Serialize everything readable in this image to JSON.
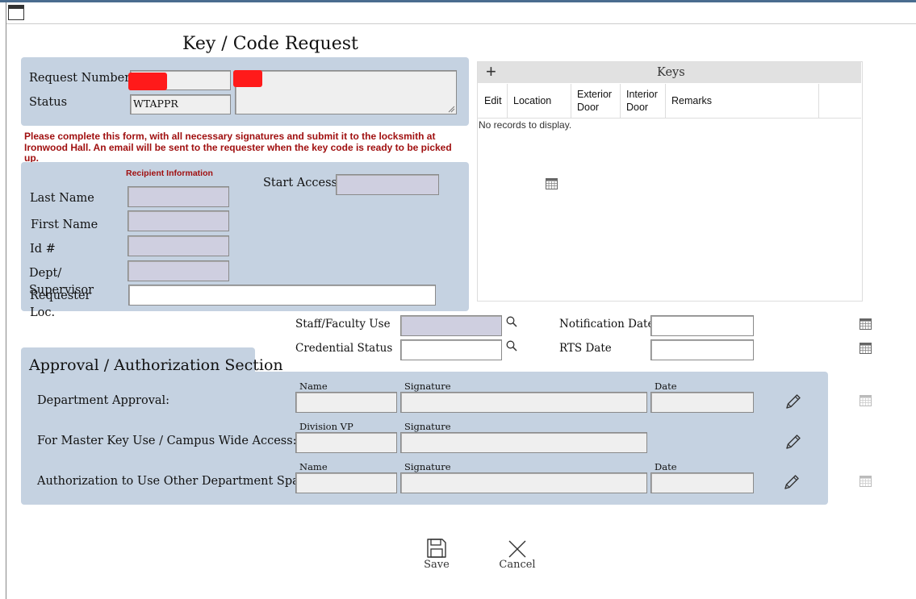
{
  "page": {
    "title": "Key / Code Request"
  },
  "request": {
    "request_number_label": "Request Number",
    "status_label": "Status",
    "status_value": "WTAPPR"
  },
  "notice": "Please complete this form, with all necessary signatures and submit it to the locksmith at Ironwood Hall. An email will be sent to the requester when the key code is ready to be picked up.",
  "recipient": {
    "section_label": "Recipient Information",
    "last_name_label": "Last Name",
    "first_name_label": "First Name",
    "id_label": "Id #",
    "dept_label": "Dept/",
    "supervisor_label": "Supervisor",
    "requester_label": "Requester",
    "loc_label": "Loc.",
    "start_access_label": "Start Access"
  },
  "keys": {
    "title": "Keys",
    "add_symbol": "+",
    "columns": [
      "Edit",
      "Location",
      "Exterior Door",
      "Interior Door",
      "Remarks"
    ],
    "empty_message": "No records to display."
  },
  "misc": {
    "staff_faculty_label": "Staff/Faculty Use",
    "credential_status_label": "Credential Status",
    "notification_date_label": "Notification Date",
    "rts_date_label": "RTS Date"
  },
  "approval": {
    "title": "Approval / Authorization Section",
    "rows": [
      {
        "label": "Department Approval:",
        "col1": "Name",
        "col2": "Signature",
        "col3": "Date"
      },
      {
        "label": "For Master Key Use / Campus Wide Access:",
        "col1": "Division VP",
        "col2": "Signature",
        "col3": ""
      },
      {
        "label": "Authorization to Use Other Department Space",
        "col1": "Name",
        "col2": "Signature",
        "col3": "Date"
      }
    ]
  },
  "actions": {
    "save_label": "Save",
    "cancel_label": "Cancel"
  },
  "icons": {
    "window": "window-icon",
    "calendar": "calendar-icon",
    "search": "search-icon",
    "pencil": "pencil-icon",
    "save": "save-icon",
    "cancel": "close-icon",
    "add": "plus-icon"
  },
  "colors": {
    "panel": "#c5d2e1",
    "notice_text": "#a01010",
    "redaction": "#ff1a1a"
  }
}
